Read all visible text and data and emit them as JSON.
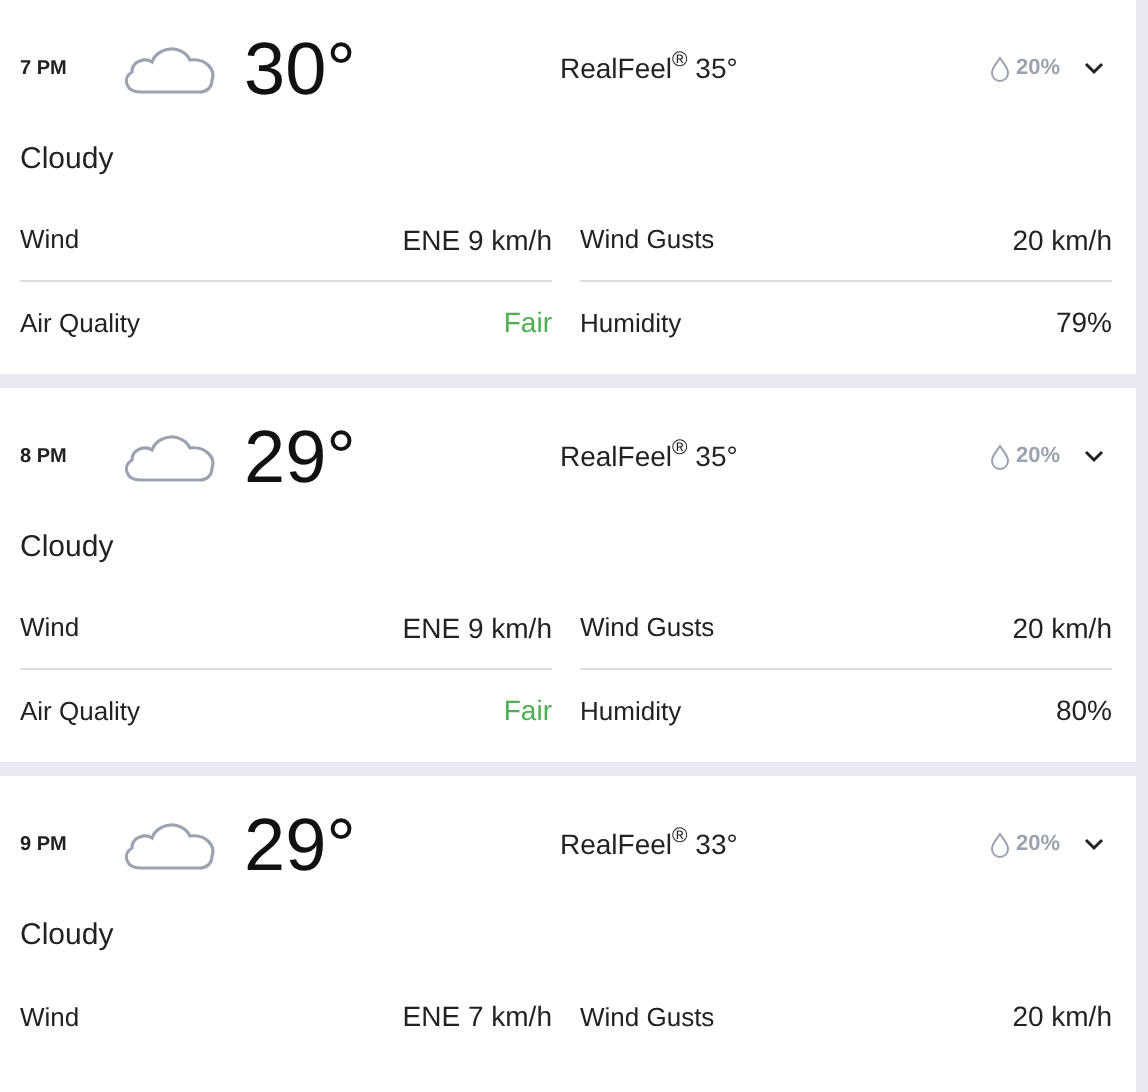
{
  "hours": [
    {
      "time": "7 PM",
      "temperature": "30°",
      "realfeel": "RealFeel$^{®}$ 35°",
      "precipitation": "20%",
      "condition": "Cloudy",
      "details": [
        {
          "label": "Wind",
          "value": "ENE 9 km/h",
          "kind": "plain"
        },
        {
          "label": "Wind Gusts",
          "value": "20 km/h",
          "kind": "plain"
        },
        {
          "label": "Air Quality",
          "value": "Fair",
          "kind": "quality"
        },
        {
          "label": "Humidity",
          "value": "79%",
          "kind": "plain"
        }
      ]
    },
    {
      "time": "8 PM",
      "temperature": "29°",
      "realfeel": "RealFeel$^{®}$ 35°",
      "precipitation": "20%",
      "condition": "Cloudy",
      "details": [
        {
          "label": "Wind",
          "value": "ENE 9 km/h",
          "kind": "plain"
        },
        {
          "label": "Wind Gusts",
          "value": "20 km/h",
          "kind": "plain"
        },
        {
          "label": "Air Quality",
          "value": "Fair",
          "kind": "quality"
        },
        {
          "label": "Humidity",
          "value": "80%",
          "kind": "plain"
        }
      ]
    },
    {
      "time": "9 PM",
      "temperature": "29°",
      "realfeel": "RealFeel$^{®}$ 33°",
      "precipitation": "20%",
      "condition": "Cloudy",
      "details": [
        {
          "label": "Wind",
          "value": "ENE 7 km/h",
          "kind": "plain"
        },
        {
          "label": "Wind Gusts",
          "value": "20 km/h",
          "kind": "plain"
        }
      ]
    }
  ]
}
